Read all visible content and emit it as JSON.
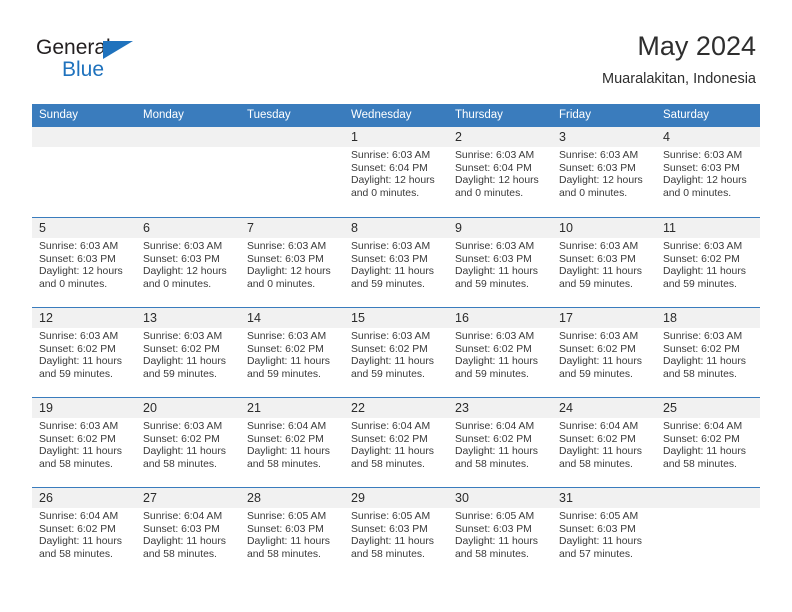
{
  "brand": {
    "name_top": "General",
    "name_bottom": "Blue"
  },
  "header": {
    "title": "May 2024",
    "location": "Muaralakitan, Indonesia"
  },
  "colors": {
    "header_blue": "#3a7cbd",
    "brand_blue": "#1f72bd",
    "daynum_band": "#f1f1f1",
    "text": "#2b2b2b"
  },
  "weekday_headers": [
    "Sunday",
    "Monday",
    "Tuesday",
    "Wednesday",
    "Thursday",
    "Friday",
    "Saturday"
  ],
  "weeks": [
    [
      {
        "day": "",
        "sunrise": "",
        "sunset": "",
        "daylight_line1": "",
        "daylight_line2": ""
      },
      {
        "day": "",
        "sunrise": "",
        "sunset": "",
        "daylight_line1": "",
        "daylight_line2": ""
      },
      {
        "day": "",
        "sunrise": "",
        "sunset": "",
        "daylight_line1": "",
        "daylight_line2": ""
      },
      {
        "day": "1",
        "sunrise": "Sunrise: 6:03 AM",
        "sunset": "Sunset: 6:04 PM",
        "daylight_line1": "Daylight: 12 hours",
        "daylight_line2": "and 0 minutes."
      },
      {
        "day": "2",
        "sunrise": "Sunrise: 6:03 AM",
        "sunset": "Sunset: 6:04 PM",
        "daylight_line1": "Daylight: 12 hours",
        "daylight_line2": "and 0 minutes."
      },
      {
        "day": "3",
        "sunrise": "Sunrise: 6:03 AM",
        "sunset": "Sunset: 6:03 PM",
        "daylight_line1": "Daylight: 12 hours",
        "daylight_line2": "and 0 minutes."
      },
      {
        "day": "4",
        "sunrise": "Sunrise: 6:03 AM",
        "sunset": "Sunset: 6:03 PM",
        "daylight_line1": "Daylight: 12 hours",
        "daylight_line2": "and 0 minutes."
      }
    ],
    [
      {
        "day": "5",
        "sunrise": "Sunrise: 6:03 AM",
        "sunset": "Sunset: 6:03 PM",
        "daylight_line1": "Daylight: 12 hours",
        "daylight_line2": "and 0 minutes."
      },
      {
        "day": "6",
        "sunrise": "Sunrise: 6:03 AM",
        "sunset": "Sunset: 6:03 PM",
        "daylight_line1": "Daylight: 12 hours",
        "daylight_line2": "and 0 minutes."
      },
      {
        "day": "7",
        "sunrise": "Sunrise: 6:03 AM",
        "sunset": "Sunset: 6:03 PM",
        "daylight_line1": "Daylight: 12 hours",
        "daylight_line2": "and 0 minutes."
      },
      {
        "day": "8",
        "sunrise": "Sunrise: 6:03 AM",
        "sunset": "Sunset: 6:03 PM",
        "daylight_line1": "Daylight: 11 hours",
        "daylight_line2": "and 59 minutes."
      },
      {
        "day": "9",
        "sunrise": "Sunrise: 6:03 AM",
        "sunset": "Sunset: 6:03 PM",
        "daylight_line1": "Daylight: 11 hours",
        "daylight_line2": "and 59 minutes."
      },
      {
        "day": "10",
        "sunrise": "Sunrise: 6:03 AM",
        "sunset": "Sunset: 6:03 PM",
        "daylight_line1": "Daylight: 11 hours",
        "daylight_line2": "and 59 minutes."
      },
      {
        "day": "11",
        "sunrise": "Sunrise: 6:03 AM",
        "sunset": "Sunset: 6:02 PM",
        "daylight_line1": "Daylight: 11 hours",
        "daylight_line2": "and 59 minutes."
      }
    ],
    [
      {
        "day": "12",
        "sunrise": "Sunrise: 6:03 AM",
        "sunset": "Sunset: 6:02 PM",
        "daylight_line1": "Daylight: 11 hours",
        "daylight_line2": "and 59 minutes."
      },
      {
        "day": "13",
        "sunrise": "Sunrise: 6:03 AM",
        "sunset": "Sunset: 6:02 PM",
        "daylight_line1": "Daylight: 11 hours",
        "daylight_line2": "and 59 minutes."
      },
      {
        "day": "14",
        "sunrise": "Sunrise: 6:03 AM",
        "sunset": "Sunset: 6:02 PM",
        "daylight_line1": "Daylight: 11 hours",
        "daylight_line2": "and 59 minutes."
      },
      {
        "day": "15",
        "sunrise": "Sunrise: 6:03 AM",
        "sunset": "Sunset: 6:02 PM",
        "daylight_line1": "Daylight: 11 hours",
        "daylight_line2": "and 59 minutes."
      },
      {
        "day": "16",
        "sunrise": "Sunrise: 6:03 AM",
        "sunset": "Sunset: 6:02 PM",
        "daylight_line1": "Daylight: 11 hours",
        "daylight_line2": "and 59 minutes."
      },
      {
        "day": "17",
        "sunrise": "Sunrise: 6:03 AM",
        "sunset": "Sunset: 6:02 PM",
        "daylight_line1": "Daylight: 11 hours",
        "daylight_line2": "and 59 minutes."
      },
      {
        "day": "18",
        "sunrise": "Sunrise: 6:03 AM",
        "sunset": "Sunset: 6:02 PM",
        "daylight_line1": "Daylight: 11 hours",
        "daylight_line2": "and 58 minutes."
      }
    ],
    [
      {
        "day": "19",
        "sunrise": "Sunrise: 6:03 AM",
        "sunset": "Sunset: 6:02 PM",
        "daylight_line1": "Daylight: 11 hours",
        "daylight_line2": "and 58 minutes."
      },
      {
        "day": "20",
        "sunrise": "Sunrise: 6:03 AM",
        "sunset": "Sunset: 6:02 PM",
        "daylight_line1": "Daylight: 11 hours",
        "daylight_line2": "and 58 minutes."
      },
      {
        "day": "21",
        "sunrise": "Sunrise: 6:04 AM",
        "sunset": "Sunset: 6:02 PM",
        "daylight_line1": "Daylight: 11 hours",
        "daylight_line2": "and 58 minutes."
      },
      {
        "day": "22",
        "sunrise": "Sunrise: 6:04 AM",
        "sunset": "Sunset: 6:02 PM",
        "daylight_line1": "Daylight: 11 hours",
        "daylight_line2": "and 58 minutes."
      },
      {
        "day": "23",
        "sunrise": "Sunrise: 6:04 AM",
        "sunset": "Sunset: 6:02 PM",
        "daylight_line1": "Daylight: 11 hours",
        "daylight_line2": "and 58 minutes."
      },
      {
        "day": "24",
        "sunrise": "Sunrise: 6:04 AM",
        "sunset": "Sunset: 6:02 PM",
        "daylight_line1": "Daylight: 11 hours",
        "daylight_line2": "and 58 minutes."
      },
      {
        "day": "25",
        "sunrise": "Sunrise: 6:04 AM",
        "sunset": "Sunset: 6:02 PM",
        "daylight_line1": "Daylight: 11 hours",
        "daylight_line2": "and 58 minutes."
      }
    ],
    [
      {
        "day": "26",
        "sunrise": "Sunrise: 6:04 AM",
        "sunset": "Sunset: 6:02 PM",
        "daylight_line1": "Daylight: 11 hours",
        "daylight_line2": "and 58 minutes."
      },
      {
        "day": "27",
        "sunrise": "Sunrise: 6:04 AM",
        "sunset": "Sunset: 6:03 PM",
        "daylight_line1": "Daylight: 11 hours",
        "daylight_line2": "and 58 minutes."
      },
      {
        "day": "28",
        "sunrise": "Sunrise: 6:05 AM",
        "sunset": "Sunset: 6:03 PM",
        "daylight_line1": "Daylight: 11 hours",
        "daylight_line2": "and 58 minutes."
      },
      {
        "day": "29",
        "sunrise": "Sunrise: 6:05 AM",
        "sunset": "Sunset: 6:03 PM",
        "daylight_line1": "Daylight: 11 hours",
        "daylight_line2": "and 58 minutes."
      },
      {
        "day": "30",
        "sunrise": "Sunrise: 6:05 AM",
        "sunset": "Sunset: 6:03 PM",
        "daylight_line1": "Daylight: 11 hours",
        "daylight_line2": "and 58 minutes."
      },
      {
        "day": "31",
        "sunrise": "Sunrise: 6:05 AM",
        "sunset": "Sunset: 6:03 PM",
        "daylight_line1": "Daylight: 11 hours",
        "daylight_line2": "and 57 minutes."
      },
      {
        "day": "",
        "sunrise": "",
        "sunset": "",
        "daylight_line1": "",
        "daylight_line2": ""
      }
    ]
  ]
}
